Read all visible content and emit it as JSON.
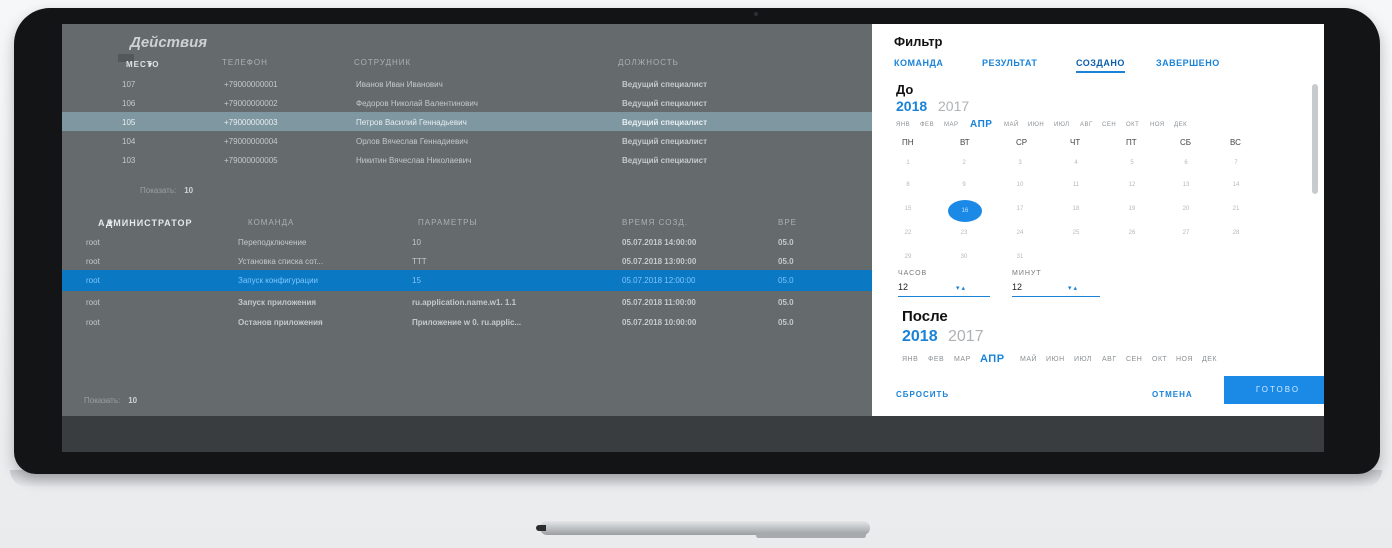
{
  "app": {
    "title": "Действия"
  },
  "table1": {
    "sort_tag": "МЕСТО",
    "headers": [
      "ТЕЛЕФОН",
      "СОТРУДНИК",
      "ДОЛЖНОСТЬ"
    ],
    "rows": [
      {
        "place": "107",
        "phone": "+79000000001",
        "employee": "Иванов Иван Иванович",
        "position": "Ведущий специалист"
      },
      {
        "place": "106",
        "phone": "+79000000002",
        "employee": "Федоров Николай Валентинович",
        "position": "Ведущий специалист"
      },
      {
        "place": "105",
        "phone": "+79000000003",
        "employee": "Петров Василий Геннадьевич",
        "position": "Ведущий специалист"
      },
      {
        "place": "104",
        "phone": "+79000000004",
        "employee": "Орлов Вячеслав Геннадиевич",
        "position": "Ведущий специалист"
      },
      {
        "place": "103",
        "phone": "+79000000005",
        "employee": "Никитин Вячеслав Николаевич",
        "position": "Ведущий специалист"
      }
    ],
    "show_label": "Показать:",
    "show_value": "10"
  },
  "table2": {
    "sort_tag": "АДМИНИСТРАТОР",
    "headers": [
      "КОМАНДА",
      "ПАРАМЕТРЫ",
      "ВРЕМЯ СОЗД.",
      "ВРЕ"
    ],
    "rows": [
      {
        "admin": "root",
        "command": "Переподключение",
        "params": "10",
        "created": "05.07.2018 14:00:00",
        "other": "05.0"
      },
      {
        "admin": "root",
        "command": "Установка списка сот...",
        "params": "TTT",
        "created": "05.07.2018 13:00:00",
        "other": "05.0"
      },
      {
        "admin": "root",
        "command": "Запуск конфигурации",
        "params": "15",
        "created": "05.07.2018 12:00:00",
        "other": "05.0"
      },
      {
        "admin": "root",
        "command": "Запуск приложения",
        "params": "ru.application.name.w1. 1.1",
        "created": "05.07.2018 11:00:00",
        "other": "05.0"
      },
      {
        "admin": "root",
        "command": "Останов приложения",
        "params": "Приложение w 0. ru.applic...",
        "created": "05.07.2018 10:00:00",
        "other": "05.0"
      }
    ],
    "show_label": "Показать:",
    "show_value": "10"
  },
  "filter": {
    "title": "Фильтр",
    "tabs": [
      "КОМАНДА",
      "РЕЗУЛЬТАТ",
      "СОЗДАНО",
      "ЗАВЕРШЕНО"
    ],
    "before": {
      "label": "До",
      "year_active": "2018",
      "year_other": "2017",
      "months": [
        "ЯНВ",
        "ФЕВ",
        "МАР",
        "АПР",
        "МАЙ",
        "ИЮН",
        "ИЮЛ",
        "АВГ",
        "СЕН",
        "ОКТ",
        "НОЯ",
        "ДЕК"
      ],
      "weekdays": [
        "ПН",
        "ВТ",
        "СР",
        "ЧТ",
        "ПТ",
        "СБ",
        "ВС"
      ],
      "days": [
        "1",
        "2",
        "3",
        "4",
        "5",
        "6",
        "7",
        "8",
        "9",
        "10",
        "11",
        "12",
        "13",
        "14",
        "15",
        "16",
        "17",
        "18",
        "19",
        "20",
        "21",
        "22",
        "23",
        "24",
        "25",
        "26",
        "27",
        "28",
        "29",
        "30",
        "31"
      ],
      "hours_label": "ЧАСОВ",
      "hours_value": "12",
      "minutes_label": "МИНУТ",
      "minutes_value": "12"
    },
    "after": {
      "label": "После",
      "year_active": "2018",
      "year_other": "2017",
      "months": [
        "ЯНВ",
        "ФЕВ",
        "МАР",
        "АПР",
        "МАЙ",
        "ИЮН",
        "ИЮЛ",
        "АВГ",
        "СЕН",
        "ОКТ",
        "НОЯ",
        "ДЕК"
      ]
    },
    "reset_label": "СБРОСИТЬ",
    "cancel_label": "ОТМЕНА",
    "done_label": "ГОТОВО"
  },
  "colors": {
    "accent": "#1a8ae6",
    "selected_row": "#0a78c2"
  }
}
